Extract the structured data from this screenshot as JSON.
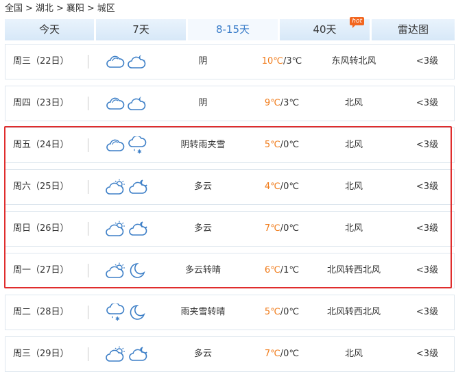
{
  "breadcrumb": {
    "items": [
      "全国",
      "湖北",
      "襄阳",
      "城区"
    ],
    "separator": ">"
  },
  "tabs": [
    {
      "label": "今天"
    },
    {
      "label": "7天"
    },
    {
      "label": "8-15天"
    },
    {
      "label": "40天",
      "badge": "hot"
    },
    {
      "label": "雷达图"
    }
  ],
  "active_tab": "8-15天",
  "colors": {
    "high_temp": "#f07a18",
    "active_tab_text": "#3a7dc9",
    "highlight_border": "#e02d2d",
    "hot_badge": "#f2661f"
  },
  "rows": [
    {
      "date": "周三（22日）",
      "icons": [
        "cloudy-icon",
        "cloudy-night-icon"
      ],
      "weather": "阴",
      "temp_high": "10℃",
      "temp_low": "/3℃",
      "wind": "东风转北风",
      "level": "<3级"
    },
    {
      "date": "周四（23日）",
      "icons": [
        "cloudy-icon",
        "cloudy-night-icon"
      ],
      "weather": "阴",
      "temp_high": "9℃",
      "temp_low": "/3℃",
      "wind": "北风",
      "level": "<3级"
    },
    {
      "date": "周五（24日）",
      "icons": [
        "cloudy-icon",
        "sleet-icon"
      ],
      "weather": "阴转雨夹雪",
      "temp_high": "5℃",
      "temp_low": "/0℃",
      "wind": "北风",
      "level": "<3级"
    },
    {
      "date": "周六（25日）",
      "icons": [
        "partly-cloudy-day-icon",
        "partly-cloudy-night-icon"
      ],
      "weather": "多云",
      "temp_high": "4℃",
      "temp_low": "/0℃",
      "wind": "北风",
      "level": "<3级"
    },
    {
      "date": "周日（26日）",
      "icons": [
        "partly-cloudy-day-icon",
        "partly-cloudy-night-icon"
      ],
      "weather": "多云",
      "temp_high": "7℃",
      "temp_low": "/0℃",
      "wind": "北风",
      "level": "<3级"
    },
    {
      "date": "周一（27日）",
      "icons": [
        "partly-cloudy-day-icon",
        "moon-icon"
      ],
      "weather": "多云转晴",
      "temp_high": "6℃",
      "temp_low": "/1℃",
      "wind": "北风转西北风",
      "level": "<3级"
    },
    {
      "date": "周二（28日）",
      "icons": [
        "sleet-icon",
        "moon-icon"
      ],
      "weather": "雨夹雪转晴",
      "temp_high": "5℃",
      "temp_low": "/0℃",
      "wind": "北风转西北风",
      "level": "<3级"
    },
    {
      "date": "周三（29日）",
      "icons": [
        "partly-cloudy-day-icon",
        "partly-cloudy-night-icon"
      ],
      "weather": "多云",
      "temp_high": "7℃",
      "temp_low": "/0℃",
      "wind": "北风",
      "level": "<3级"
    }
  ]
}
